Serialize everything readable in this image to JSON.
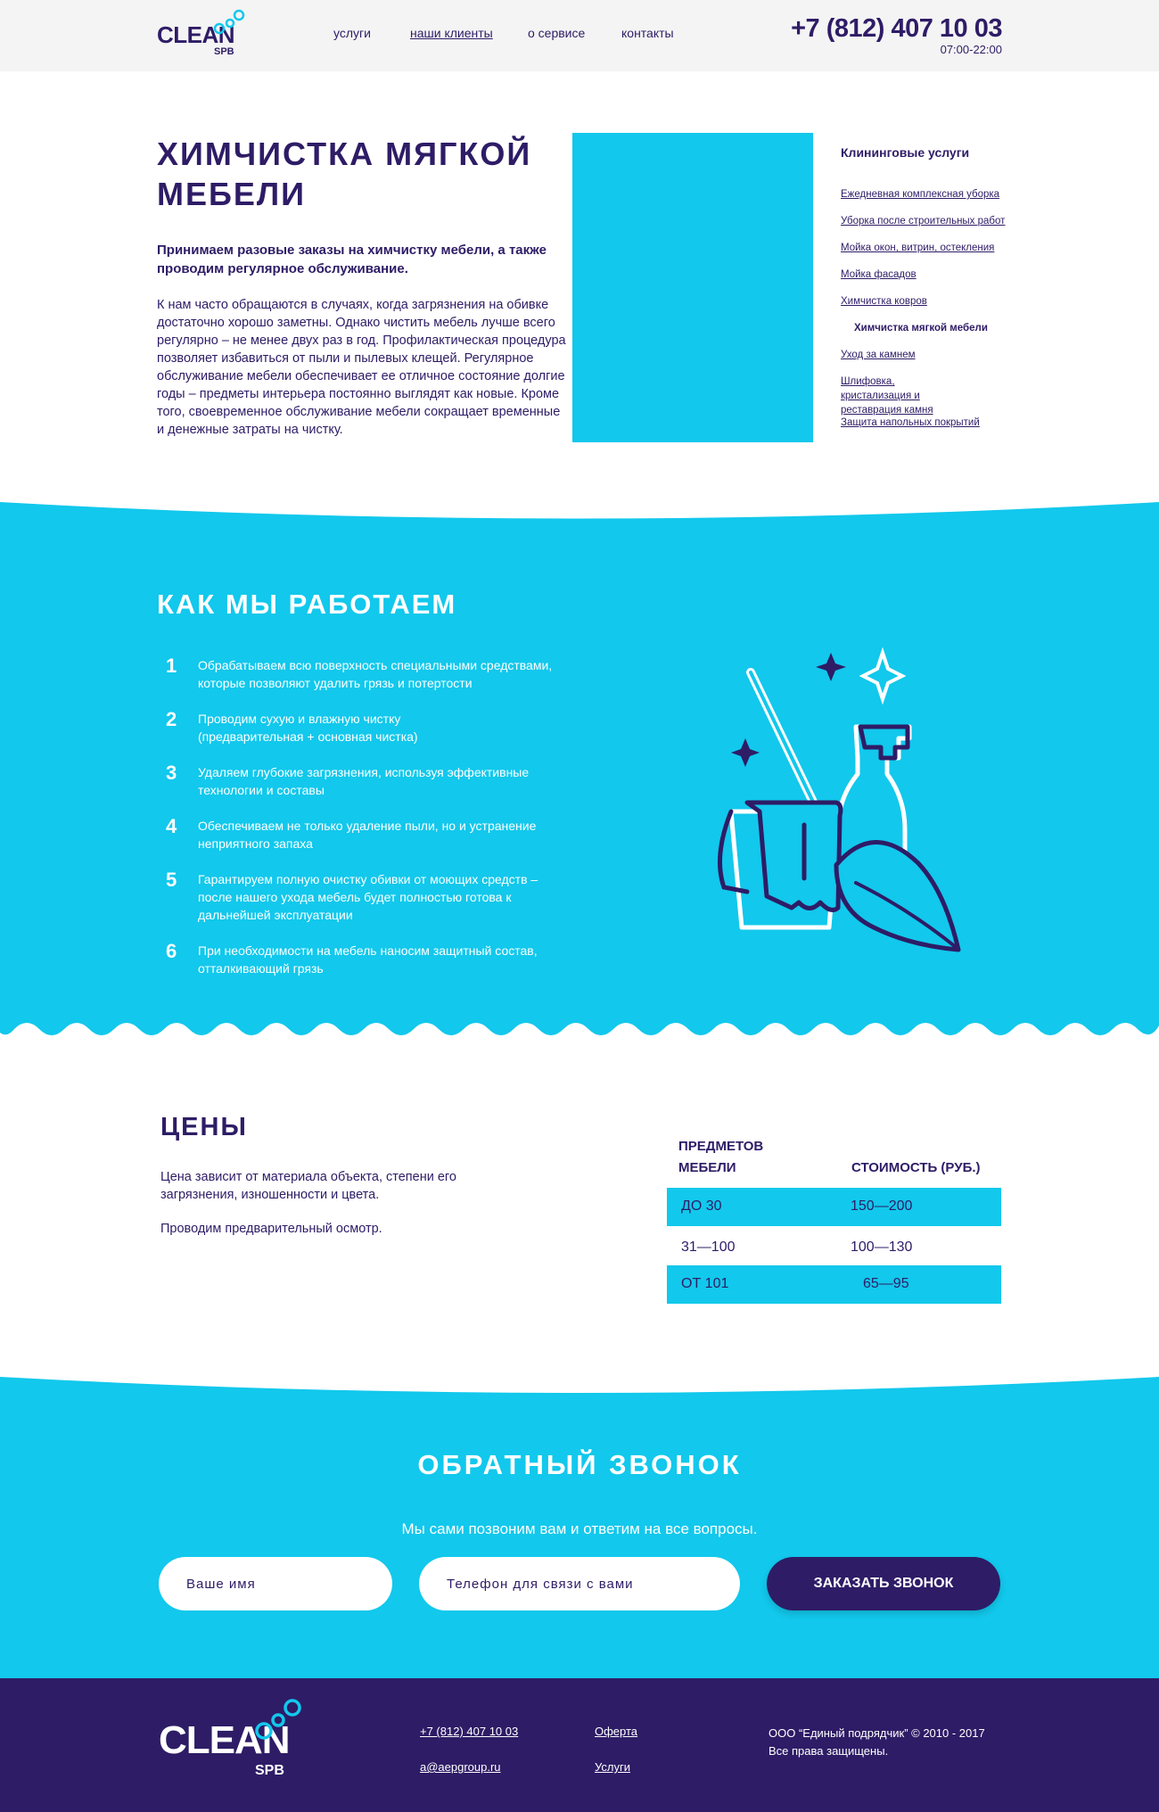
{
  "header": {
    "logo_word": "CLEAN",
    "logo_sub": "SPB",
    "nav": [
      "услуги",
      "наши клиенты",
      "о сервисе",
      "контакты"
    ],
    "phone": "+7 (812) 407 10 03",
    "hours": "07:00-22:00"
  },
  "intro": {
    "title": "ХИМЧИСТКА МЯГКОЙ МЕБЕЛИ",
    "lead": "Принимаем разовые заказы на химчистку мебели, а также проводим регулярное обслуживание.",
    "body": "К нам часто обращаются в случаях, когда загрязнения на обивке достаточно хорошо заметны. Однако чистить мебель лучше всего регулярно – не менее двух раз в год. Профилактическая процедура позволяет избавиться от пыли и пылевых клещей. Регулярное обслуживание мебели обеспечивает ее отличное состояние долгие годы – предметы интерьера постоянно выглядят как новые. Кроме того, своевременное обслуживание мебели сокращает временные и денежные затраты на чистку."
  },
  "sidebar": {
    "title": "Клининговые услуги",
    "items": [
      "Ежедневная комплексная уборка",
      "Уборка после строительных работ",
      "Мойка окон, витрин, остекления",
      "Мойка фасадов",
      "Химчистка ковров",
      "Химчистка мягкой мебели",
      "Уход за камнем",
      "Шлифовка, кристализация и реставрация камня",
      "Защита напольных покрытий"
    ]
  },
  "how": {
    "title": "КАК МЫ РАБОТАЕМ",
    "steps": [
      {
        "num": "1",
        "text": "Обрабатываем всю поверхность специальными средствами, которые позволяют удалить грязь и потертости"
      },
      {
        "num": "2",
        "text": "Проводим сухую и влажную чистку (предварительная + основная чистка)"
      },
      {
        "num": "3",
        "text": "Удаляем глубокие загрязнения, используя эффективные технологии и составы"
      },
      {
        "num": "4",
        "text": "Обеспечиваем не только удаление пыли, но и устранение неприятного запаха"
      },
      {
        "num": "5",
        "text": "Гарантируем полную очистку обивки от моющих средств – после нашего ухода мебель будет полностью готова к дальнейшей эксплуатации"
      },
      {
        "num": "6",
        "text": "При необходимости на мебель наносим защитный состав, отталкивающий грязь"
      }
    ]
  },
  "prices": {
    "title": "ЦЕНЫ",
    "text": "Цена зависит от материала объекта, степени его загрязнения, изношенности и цвета.",
    "note": "Проводим предварительный осмотр.",
    "headers": [
      "ПРЕДМЕТОВ МЕБЕЛИ",
      "СТОИМОСТЬ (РУБ.)"
    ],
    "rows": [
      {
        "qty": "ДО 30",
        "price": "150—200"
      },
      {
        "qty": "31—100",
        "price": "100—130"
      },
      {
        "qty": "ОТ 101",
        "price": "65—95"
      }
    ]
  },
  "callback": {
    "title": "ОБРАТНЫЙ ЗВОНОК",
    "subtitle": "Мы сами позвоним вам и ответим на все вопросы.",
    "name_placeholder": "Ваше имя",
    "phone_placeholder": "Телефон для связи с вами",
    "button": "ЗАКАЗАТЬ ЗВОНОК"
  },
  "footer": {
    "logo_word": "CLEAN",
    "logo_sub": "SPB",
    "phone": "+7 (812) 407 10 03",
    "email": "a@aepgroup.ru",
    "offer": "Оферта",
    "services": "Услуги",
    "copyright": "ООО “Единый подрядчик” © 2010 - 2017",
    "rights": "Все права защищены."
  },
  "colors": {
    "navy": "#2e1c66",
    "cyan": "#12c8ec",
    "header_bg": "#f4f4f4"
  }
}
